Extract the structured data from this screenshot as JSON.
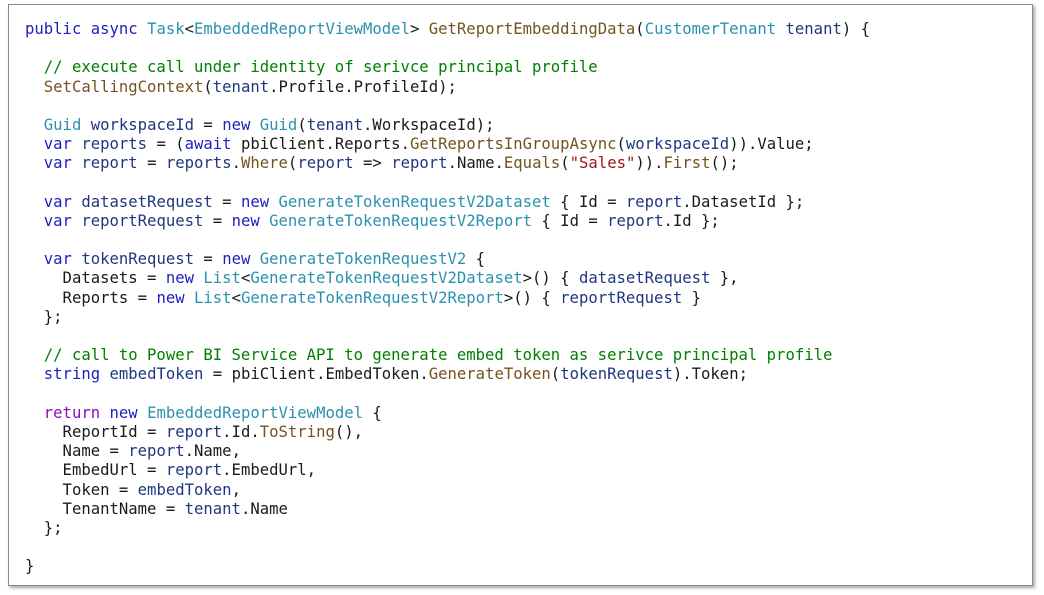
{
  "code_lines": [
    [
      {
        "t": "public",
        "c": "kw"
      },
      {
        "t": " ",
        "c": ""
      },
      {
        "t": "async",
        "c": "kw"
      },
      {
        "t": " ",
        "c": ""
      },
      {
        "t": "Task",
        "c": "ty"
      },
      {
        "t": "<",
        "c": ""
      },
      {
        "t": "EmbeddedReportViewModel",
        "c": "ty"
      },
      {
        "t": "> ",
        "c": ""
      },
      {
        "t": "GetReportEmbeddingData",
        "c": "mt"
      },
      {
        "t": "(",
        "c": ""
      },
      {
        "t": "CustomerTenant",
        "c": "ty"
      },
      {
        "t": " ",
        "c": ""
      },
      {
        "t": "tenant",
        "c": "pl"
      },
      {
        "t": ") {",
        "c": ""
      }
    ],
    [],
    [
      {
        "t": "  // execute call under identity of serivce principal profile",
        "c": "cm"
      }
    ],
    [
      {
        "t": "  ",
        "c": ""
      },
      {
        "t": "SetCallingContext",
        "c": "mt"
      },
      {
        "t": "(",
        "c": ""
      },
      {
        "t": "tenant",
        "c": "pl"
      },
      {
        "t": ".Profile.ProfileId);",
        "c": ""
      }
    ],
    [],
    [
      {
        "t": "  ",
        "c": ""
      },
      {
        "t": "Guid",
        "c": "ty"
      },
      {
        "t": " ",
        "c": ""
      },
      {
        "t": "workspaceId",
        "c": "pl"
      },
      {
        "t": " = ",
        "c": ""
      },
      {
        "t": "new",
        "c": "kw"
      },
      {
        "t": " ",
        "c": ""
      },
      {
        "t": "Guid",
        "c": "ty"
      },
      {
        "t": "(",
        "c": ""
      },
      {
        "t": "tenant",
        "c": "pl"
      },
      {
        "t": ".WorkspaceId);",
        "c": ""
      }
    ],
    [
      {
        "t": "  ",
        "c": ""
      },
      {
        "t": "var",
        "c": "kw"
      },
      {
        "t": " ",
        "c": ""
      },
      {
        "t": "reports",
        "c": "pl"
      },
      {
        "t": " = (",
        "c": ""
      },
      {
        "t": "await",
        "c": "kw"
      },
      {
        "t": " pbiClient.Reports.",
        "c": ""
      },
      {
        "t": "GetReportsInGroupAsync",
        "c": "mt"
      },
      {
        "t": "(",
        "c": ""
      },
      {
        "t": "workspaceId",
        "c": "pl"
      },
      {
        "t": ")).Value;",
        "c": ""
      }
    ],
    [
      {
        "t": "  ",
        "c": ""
      },
      {
        "t": "var",
        "c": "kw"
      },
      {
        "t": " ",
        "c": ""
      },
      {
        "t": "report",
        "c": "pl"
      },
      {
        "t": " = ",
        "c": ""
      },
      {
        "t": "reports",
        "c": "pl"
      },
      {
        "t": ".",
        "c": ""
      },
      {
        "t": "Where",
        "c": "mt"
      },
      {
        "t": "(",
        "c": ""
      },
      {
        "t": "report",
        "c": "pl"
      },
      {
        "t": " => ",
        "c": ""
      },
      {
        "t": "report",
        "c": "pl"
      },
      {
        "t": ".Name.",
        "c": ""
      },
      {
        "t": "Equals",
        "c": "mt"
      },
      {
        "t": "(",
        "c": ""
      },
      {
        "t": "\"Sales\"",
        "c": "st"
      },
      {
        "t": ")).",
        "c": ""
      },
      {
        "t": "First",
        "c": "mt"
      },
      {
        "t": "();",
        "c": ""
      }
    ],
    [],
    [
      {
        "t": "  ",
        "c": ""
      },
      {
        "t": "var",
        "c": "kw"
      },
      {
        "t": " ",
        "c": ""
      },
      {
        "t": "datasetRequest",
        "c": "pl"
      },
      {
        "t": " = ",
        "c": ""
      },
      {
        "t": "new",
        "c": "kw"
      },
      {
        "t": " ",
        "c": ""
      },
      {
        "t": "GenerateTokenRequestV2Dataset",
        "c": "ty"
      },
      {
        "t": " { Id = ",
        "c": ""
      },
      {
        "t": "report",
        "c": "pl"
      },
      {
        "t": ".DatasetId };",
        "c": ""
      }
    ],
    [
      {
        "t": "  ",
        "c": ""
      },
      {
        "t": "var",
        "c": "kw"
      },
      {
        "t": " ",
        "c": ""
      },
      {
        "t": "reportRequest",
        "c": "pl"
      },
      {
        "t": " = ",
        "c": ""
      },
      {
        "t": "new",
        "c": "kw"
      },
      {
        "t": " ",
        "c": ""
      },
      {
        "t": "GenerateTokenRequestV2Report",
        "c": "ty"
      },
      {
        "t": " { Id = ",
        "c": ""
      },
      {
        "t": "report",
        "c": "pl"
      },
      {
        "t": ".Id };",
        "c": ""
      }
    ],
    [],
    [
      {
        "t": "  ",
        "c": ""
      },
      {
        "t": "var",
        "c": "kw"
      },
      {
        "t": " ",
        "c": ""
      },
      {
        "t": "tokenRequest",
        "c": "pl"
      },
      {
        "t": " = ",
        "c": ""
      },
      {
        "t": "new",
        "c": "kw"
      },
      {
        "t": " ",
        "c": ""
      },
      {
        "t": "GenerateTokenRequestV2",
        "c": "ty"
      },
      {
        "t": " {",
        "c": ""
      }
    ],
    [
      {
        "t": "    Datasets = ",
        "c": ""
      },
      {
        "t": "new",
        "c": "kw"
      },
      {
        "t": " ",
        "c": ""
      },
      {
        "t": "List",
        "c": "ty"
      },
      {
        "t": "<",
        "c": ""
      },
      {
        "t": "GenerateTokenRequestV2Dataset",
        "c": "ty"
      },
      {
        "t": ">() { ",
        "c": ""
      },
      {
        "t": "datasetRequest",
        "c": "pl"
      },
      {
        "t": " },",
        "c": ""
      }
    ],
    [
      {
        "t": "    Reports = ",
        "c": ""
      },
      {
        "t": "new",
        "c": "kw"
      },
      {
        "t": " ",
        "c": ""
      },
      {
        "t": "List",
        "c": "ty"
      },
      {
        "t": "<",
        "c": ""
      },
      {
        "t": "GenerateTokenRequestV2Report",
        "c": "ty"
      },
      {
        "t": ">() { ",
        "c": ""
      },
      {
        "t": "reportRequest",
        "c": "pl"
      },
      {
        "t": " }",
        "c": ""
      }
    ],
    [
      {
        "t": "  };",
        "c": ""
      }
    ],
    [],
    [
      {
        "t": "  // call to Power BI Service API to generate embed token as serivce principal profile",
        "c": "cm"
      }
    ],
    [
      {
        "t": "  ",
        "c": ""
      },
      {
        "t": "string",
        "c": "kw"
      },
      {
        "t": " ",
        "c": ""
      },
      {
        "t": "embedToken",
        "c": "pl"
      },
      {
        "t": " = pbiClient.EmbedToken.",
        "c": ""
      },
      {
        "t": "GenerateToken",
        "c": "mt"
      },
      {
        "t": "(",
        "c": ""
      },
      {
        "t": "tokenRequest",
        "c": "pl"
      },
      {
        "t": ").Token;",
        "c": ""
      }
    ],
    [],
    [
      {
        "t": "  ",
        "c": ""
      },
      {
        "t": "return",
        "c": "ct"
      },
      {
        "t": " ",
        "c": ""
      },
      {
        "t": "new",
        "c": "kw"
      },
      {
        "t": " ",
        "c": ""
      },
      {
        "t": "EmbeddedReportViewModel",
        "c": "ty"
      },
      {
        "t": " {",
        "c": ""
      }
    ],
    [
      {
        "t": "    ReportId = ",
        "c": ""
      },
      {
        "t": "report",
        "c": "pl"
      },
      {
        "t": ".Id.",
        "c": ""
      },
      {
        "t": "ToString",
        "c": "mt"
      },
      {
        "t": "(),",
        "c": ""
      }
    ],
    [
      {
        "t": "    Name = ",
        "c": ""
      },
      {
        "t": "report",
        "c": "pl"
      },
      {
        "t": ".Name,",
        "c": ""
      }
    ],
    [
      {
        "t": "    EmbedUrl = ",
        "c": ""
      },
      {
        "t": "report",
        "c": "pl"
      },
      {
        "t": ".EmbedUrl,",
        "c": ""
      }
    ],
    [
      {
        "t": "    Token = ",
        "c": ""
      },
      {
        "t": "embedToken",
        "c": "pl"
      },
      {
        "t": ",",
        "c": ""
      }
    ],
    [
      {
        "t": "    TenantName = ",
        "c": ""
      },
      {
        "t": "tenant",
        "c": "pl"
      },
      {
        "t": ".Name",
        "c": ""
      }
    ],
    [
      {
        "t": "  };",
        "c": ""
      }
    ],
    [],
    [
      {
        "t": "}",
        "c": ""
      }
    ]
  ],
  "colors": {
    "keyword": "#2020c0",
    "type": "#2b91af",
    "method": "#74531f",
    "parameter": "#1f377f",
    "comment": "#008000",
    "string": "#a31515",
    "control": "#8f08c4",
    "plain": "#1a1a1a"
  }
}
